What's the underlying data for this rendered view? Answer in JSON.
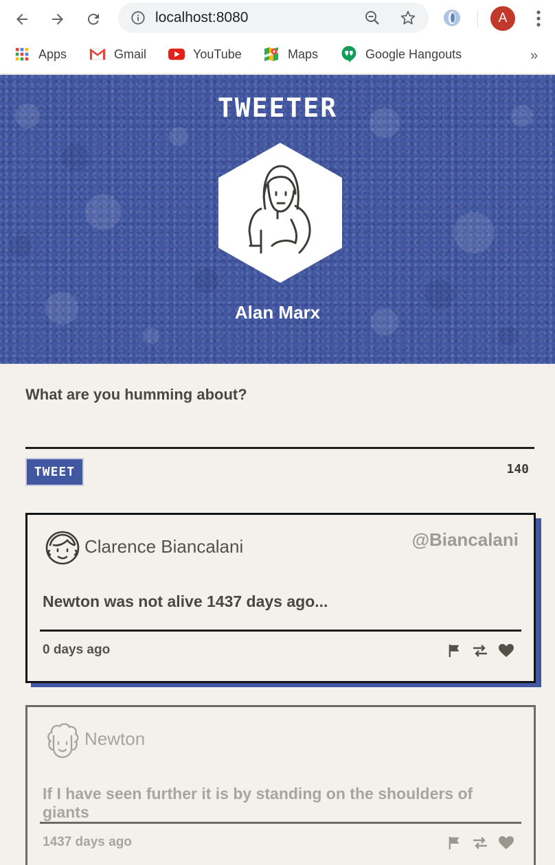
{
  "browser": {
    "url": "localhost:8080",
    "avatar_letter": "A",
    "avatar_color": "#c0392b",
    "bookmarks": [
      {
        "label": "Apps",
        "icon": "apps-grid-icon"
      },
      {
        "label": "Gmail",
        "icon": "gmail-icon"
      },
      {
        "label": "YouTube",
        "icon": "youtube-icon"
      },
      {
        "label": "Maps",
        "icon": "maps-icon"
      },
      {
        "label": "Google Hangouts",
        "icon": "hangouts-icon"
      }
    ],
    "more": "»"
  },
  "header": {
    "title": "TWEETER",
    "profile_name": "Alan Marx",
    "background_color": "#4257a1"
  },
  "compose": {
    "label": "What are you humming about?",
    "button_label": "TWEET",
    "char_counter": "140"
  },
  "tweets": [
    {
      "author": "Clarence Biancalani",
      "handle": "@Biancalani",
      "content": "Newton was not alive 1437 days ago...",
      "timestamp": "0 days ago",
      "state": "active"
    },
    {
      "author": "Newton",
      "handle": "",
      "content": "If I have seen further it is by standing on the shoulders of giants",
      "timestamp": "1437 days ago",
      "state": "faded"
    }
  ],
  "colors": {
    "accent": "#4257a1",
    "page_bg": "#f4f1ec",
    "text": "#545149"
  }
}
